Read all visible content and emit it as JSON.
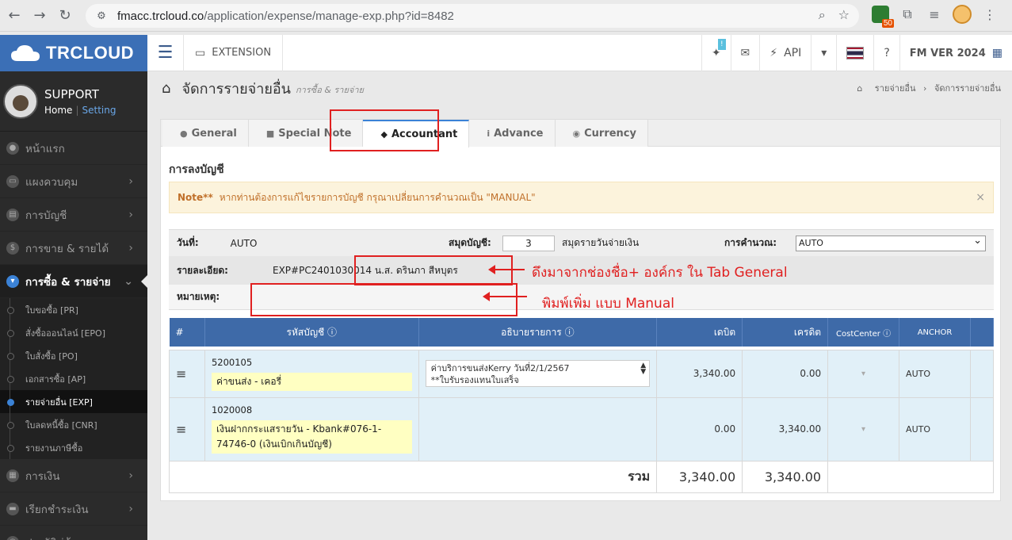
{
  "browser": {
    "url_domain": "fmacc.trcloud.co",
    "url_path": "/application/expense/manage-exp.php?id=8482",
    "ext_count": "50"
  },
  "sidebar": {
    "logo": "TRCLOUD",
    "user_name": "SUPPORT",
    "home_link": "Home",
    "setting_link": "Setting",
    "menu": [
      {
        "label": "หน้าแรก"
      },
      {
        "label": "แผงควบคุม"
      },
      {
        "label": "การบัญชี"
      },
      {
        "label": "การขาย & รายได้"
      },
      {
        "label": "การซื้อ & รายจ่าย"
      }
    ],
    "submenu": [
      {
        "label": "ใบขอซื้อ [PR]"
      },
      {
        "label": "สั่งซื้อออนไลน์ [EPO]"
      },
      {
        "label": "ใบสั่งซื้อ [PO]"
      },
      {
        "label": "เอกสารซื้อ [AP]"
      },
      {
        "label": "รายจ่ายอื่น [EXP]"
      },
      {
        "label": "ใบลดหนี้ซื้อ [CNR]"
      },
      {
        "label": "รายงานภาษีซื้อ"
      }
    ],
    "menu2": [
      {
        "label": "การเงิน"
      },
      {
        "label": "เรียกชำระเงิน"
      },
      {
        "label": "ประวัติคู่ค้า"
      }
    ]
  },
  "topnav": {
    "extension": "EXTENSION",
    "api": "API",
    "version": "FM VER 2024",
    "badge": "!"
  },
  "page": {
    "title": "จัดการรายจ่ายอื่น",
    "subtitle": "การซื้อ & รายจ่าย",
    "crumb1": "รายจ่ายอื่น",
    "crumb2": "จัดการรายจ่ายอื่น"
  },
  "tabs": [
    {
      "label": "General"
    },
    {
      "label": "Special Note"
    },
    {
      "label": "Accountant"
    },
    {
      "label": "Advance"
    },
    {
      "label": "Currency"
    }
  ],
  "section": {
    "title": "การลงบัญชี",
    "note_label": "Note**",
    "note_text": "หากท่านต้องการแก้ไขรายการบัญชี กรุณาเปลี่ยนการคำนวณเป็น \"MANUAL\"",
    "date_label": "วันที่:",
    "date_value": "AUTO",
    "book_label": "สมุดบัญชี:",
    "book_value": "3",
    "book_name": "สมุดรายวันจ่ายเงิน",
    "calc_label": "การคำนวณ:",
    "calc_value": "AUTO",
    "detail_label": "รายละเอียด:",
    "detail_value": "EXP#PC2401030014 น.ส. ดรินภา สีหบุตร",
    "remark_label": "หมายเหตุ:"
  },
  "table": {
    "headers": [
      "#",
      "รหัสบัญชี",
      "อธิบายรายการ",
      "เดบิต",
      "เครดิต",
      "CostCenter",
      "ANCHOR"
    ],
    "rows": [
      {
        "code": "5200105",
        "name": "ค่าขนส่ง - เคอรี่",
        "desc": "ค่าบริการขนส่งKerry วันที่2/1/2567\n**ใบรับรองแทนใบเสร็จ",
        "debit": "3,340.00",
        "credit": "0.00",
        "anchor": "AUTO"
      },
      {
        "code": "1020008",
        "name": "เงินฝากกระแสรายวัน - Kbank#076-1-74746-0 (เงินเบิกเกินบัญชี)",
        "desc": "",
        "debit": "0.00",
        "credit": "3,340.00",
        "anchor": "AUTO"
      }
    ],
    "total_label": "รวม",
    "total_debit": "3,340.00",
    "total_credit": "3,340.00"
  },
  "annotations": {
    "a1": "ดึงมาจากช่องชื่อ+ องค์กร ใน Tab General",
    "a2": "พิมพ์เพิ่ม แบบ Manual"
  },
  "colors": {
    "accent": "#3e6aa8",
    "annotation": "#e02020",
    "note_bg": "#fcf3dc"
  }
}
